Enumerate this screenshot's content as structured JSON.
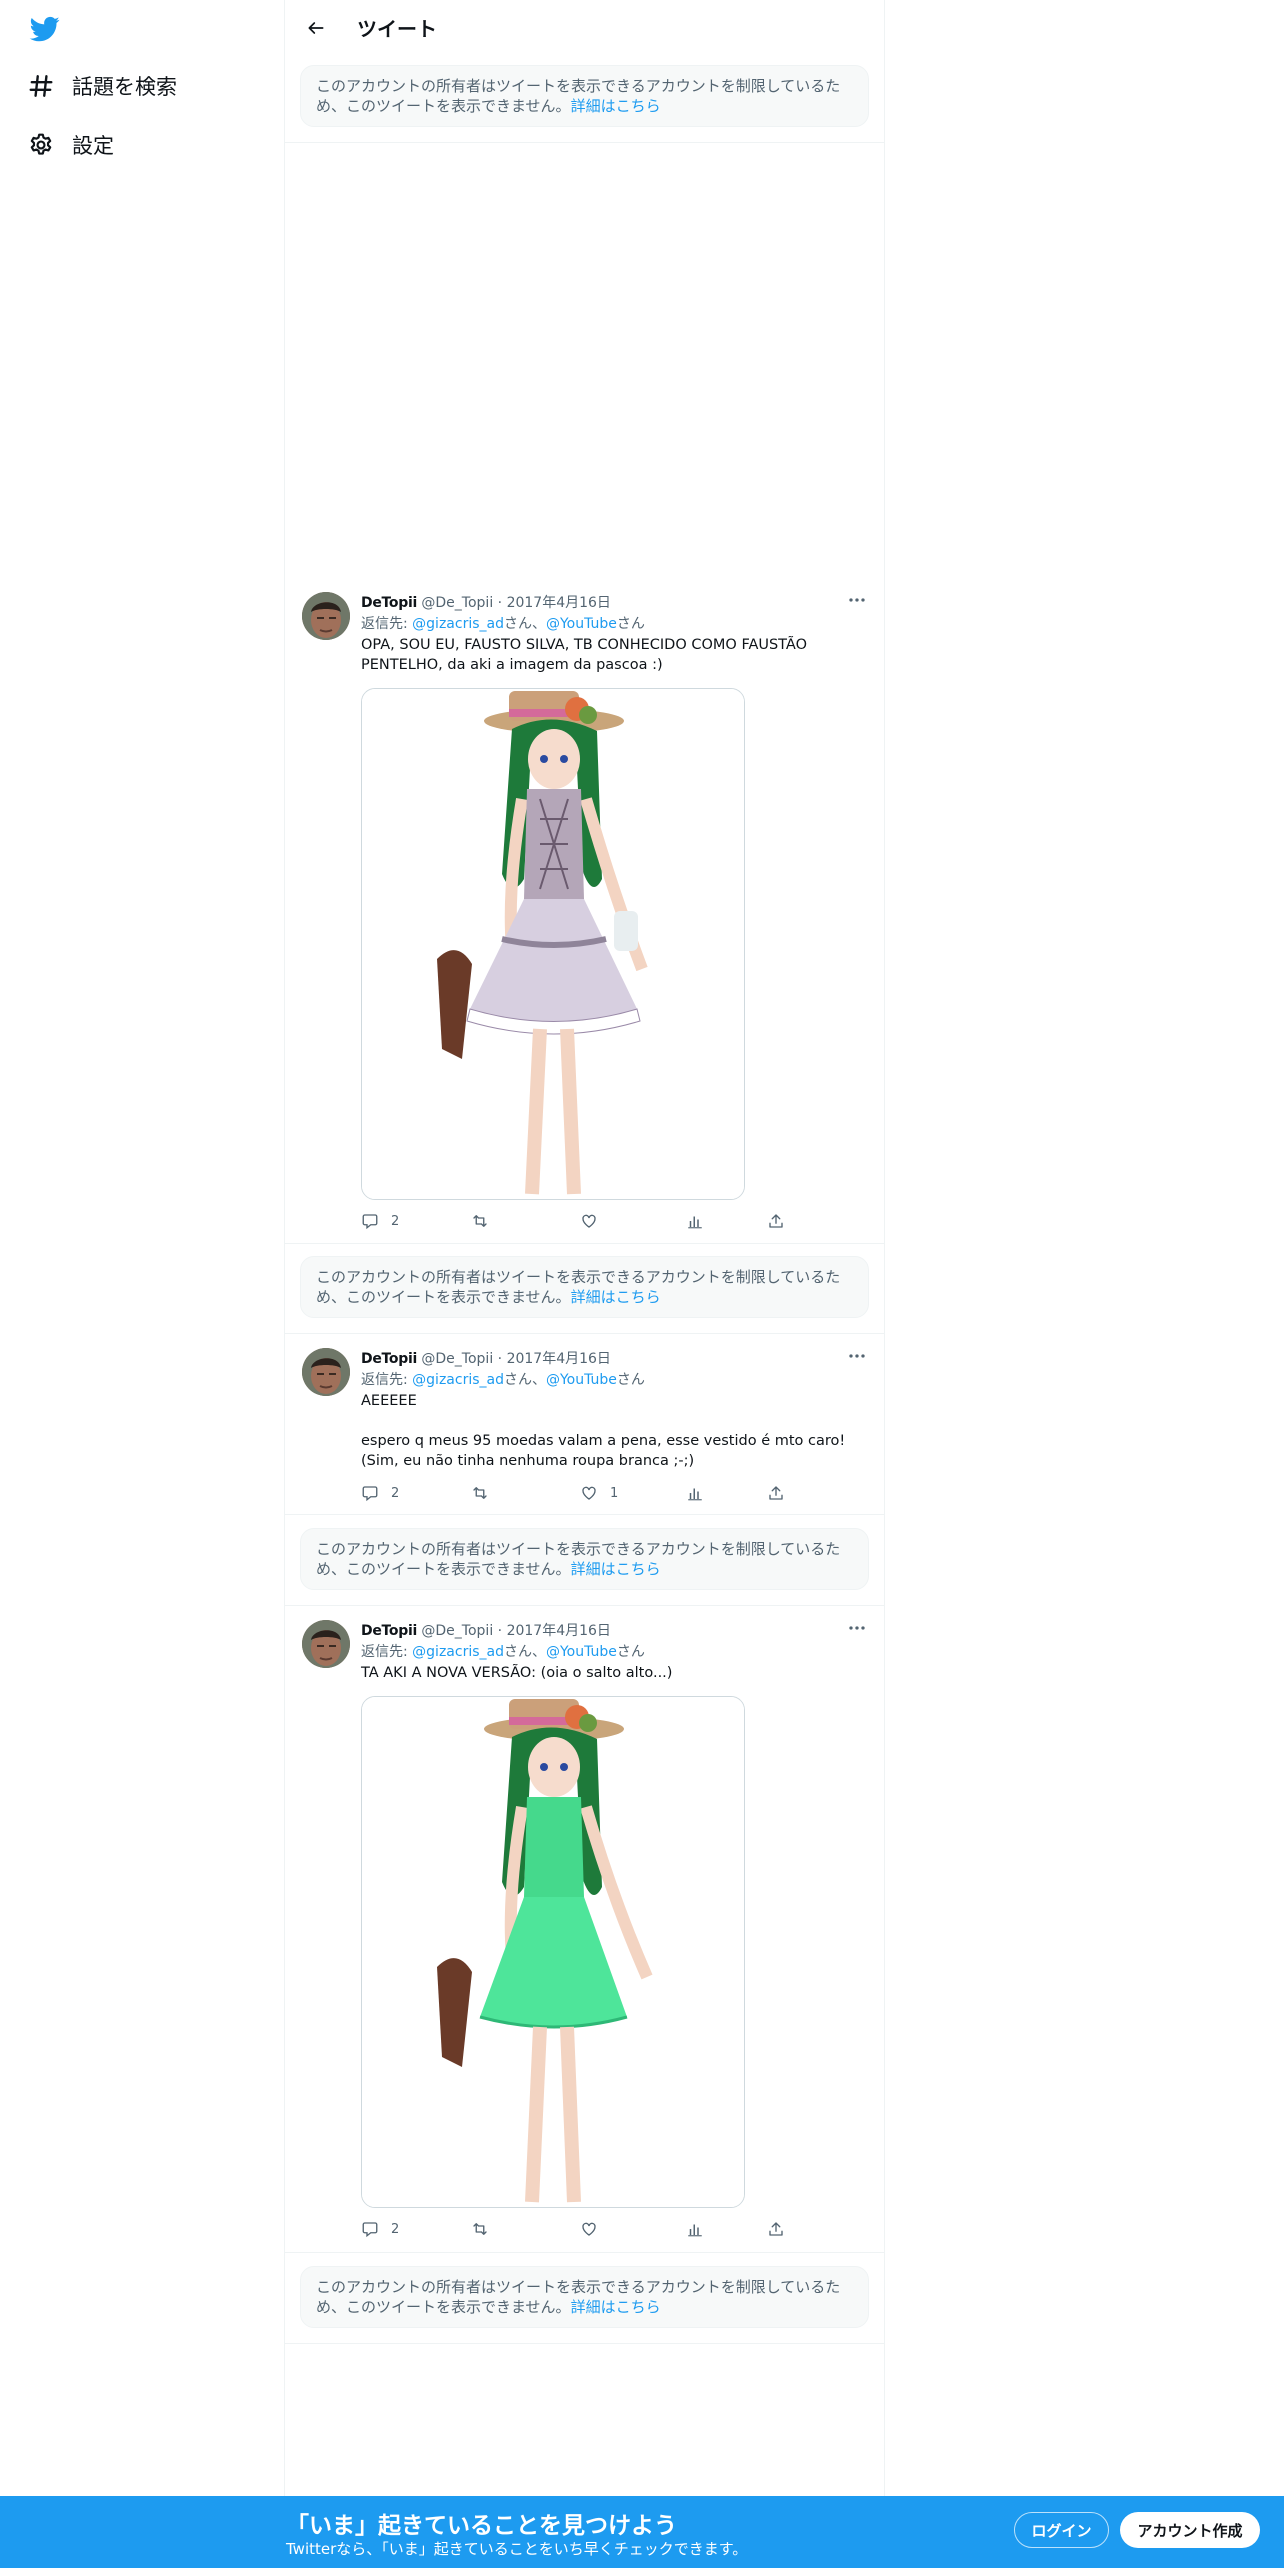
{
  "nav": {
    "explore_label": "話題を検索",
    "settings_label": "設定"
  },
  "header": {
    "title": "ツイート"
  },
  "restricted": {
    "text": "このアカウントの所有者はツイートを表示できるアカウントを制限しているため、このツイートを表示できません。",
    "link": "詳細はこちら"
  },
  "tweets": [
    {
      "name": "DeTopii",
      "handle": "@De_Topii",
      "sep": "·",
      "date": "2017年4月16日",
      "reply_prefix": "返信先: ",
      "reply_user1": "@gizacris_ad",
      "reply_san1": "さん、",
      "reply_user2": "@YouTube",
      "reply_san2": "さん",
      "text": "OPA, SOU EU, FAUSTO SILVA, TB CONHECIDO COMO FAUSTÃO PENTELHO, da aki a imagem da pascoa :)",
      "replies": "2",
      "retweets": "",
      "likes": ""
    },
    {
      "name": "DeTopii",
      "handle": "@De_Topii",
      "sep": "·",
      "date": "2017年4月16日",
      "reply_prefix": "返信先: ",
      "reply_user1": "@gizacris_ad",
      "reply_san1": "さん、",
      "reply_user2": "@YouTube",
      "reply_san2": "さん",
      "text": "AEEEEE\n\nespero q meus 95 moedas valam a pena, esse vestido é mto caro! (Sim, eu não tinha nenhuma roupa branca ;-;)",
      "replies": "2",
      "retweets": "",
      "likes": "1"
    },
    {
      "name": "DeTopii",
      "handle": "@De_Topii",
      "sep": "·",
      "date": "2017年4月16日",
      "reply_prefix": "返信先: ",
      "reply_user1": "@gizacris_ad",
      "reply_san1": "さん、",
      "reply_user2": "@YouTube",
      "reply_san2": "さん",
      "text": "TA AKI A NOVA VERSÃO: (oia o salto alto...)",
      "replies": "2",
      "retweets": "",
      "likes": ""
    }
  ],
  "bottom_bar": {
    "title": "「いま」起きていることを見つけよう",
    "subtitle": "Twitterなら、「いま」起きていることをいち早くチェックできます。",
    "login": "ログイン",
    "signup": "アカウント作成"
  },
  "colors": {
    "accent": "#1d9bf0",
    "text": "#0f1419",
    "muted": "#536471",
    "border": "#eff3f4"
  }
}
